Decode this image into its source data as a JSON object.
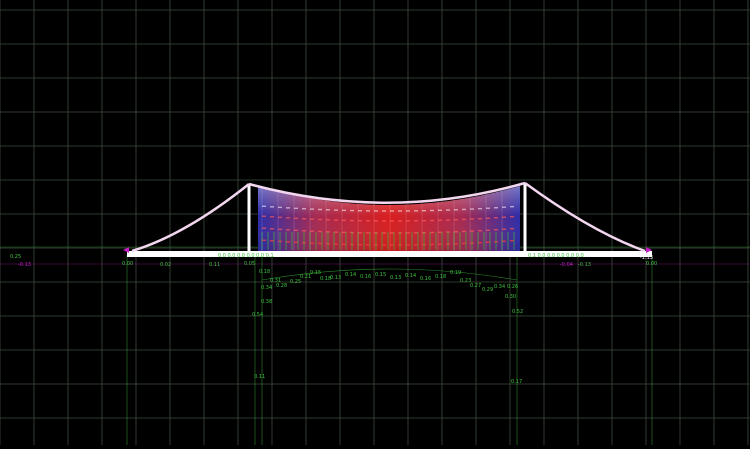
{
  "viewport": {
    "colors": {
      "background": "#000000",
      "grid": "#3c4a3c",
      "structure": "#ffffff",
      "cable": "#f3d6ef",
      "label_green": "#3fc23f",
      "label_magenta": "#c41fc4",
      "fill_blue": "#2a2aa0",
      "fill_red": "#d01e1e"
    },
    "left_axis_labels": [
      "0.25",
      "-0.13"
    ],
    "left_abutment_label": "0.00",
    "right_abutment_label": "-1.13",
    "right_side_labels": [
      "-0.04",
      "-0.13",
      "0.00"
    ],
    "left_side_labels": [
      "0.02",
      "0.11",
      "0.05"
    ],
    "mid_labels": [
      "0.13",
      "0.14",
      "0.15",
      "0.16",
      "0.18",
      "0.19",
      "0.21",
      "0.23",
      "0.25",
      "0.27",
      "0.28",
      "0.29",
      "0.31",
      "0.34"
    ],
    "tower_left_labels": [
      "0.18",
      "0.34",
      "0.38",
      "0.54",
      "0.11"
    ],
    "tower_right_labels": [
      "0.26",
      "0.30",
      "0.52",
      "0.17"
    ],
    "deck_values_left": "0.0 0.0 0.0 0.0 0.0 0.1",
    "deck_values_right": "0.1 0.0 0.0 0.0 0.0 0.0"
  }
}
